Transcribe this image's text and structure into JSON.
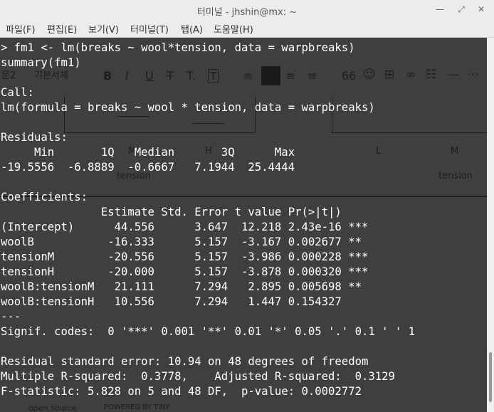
{
  "window": {
    "title": "터미널 - jhshin@mx: ~",
    "controls": [
      "—",
      "⤢",
      "✕"
    ]
  },
  "menu": [
    "파일(F)",
    "편집(E)",
    "보기(V)",
    "터미널(T)",
    "탭(A)",
    "도움말(H)"
  ],
  "background_editor": {
    "style_dropdown": "문2",
    "font_dropdown": "기본서체",
    "plot_labels": [
      "M",
      "H",
      "L",
      "M",
      "tension",
      "tension"
    ],
    "footer": [
      "open source",
      "POWERED BY TINY"
    ],
    "toolbar_icons": [
      "bold-icon",
      "italic-icon",
      "underline-icon",
      "strikethrough-icon",
      "text-color-icon",
      "text-frame-icon",
      "align-left-icon",
      "align-center-icon",
      "align-right-icon",
      "align-justify-icon",
      "quote-icon",
      "emoji-icon",
      "table-icon",
      "link-icon",
      "list-icon",
      "hr-icon",
      "more-icon"
    ]
  },
  "terminal": {
    "lines": [
      "> fm1 <- lm(breaks ~ wool*tension, data = warpbreaks)",
      "summary(fm1)",
      "",
      "Call:",
      "lm(formula = breaks ~ wool * tension, data = warpbreaks)",
      "",
      "Residuals:",
      "     Min       1Q   Median       3Q      Max ",
      "-19.5556  -6.8889  -0.6667   7.1944  25.4444 ",
      "",
      "Coefficients:",
      "               Estimate Std. Error t value Pr(>|t|)    ",
      "(Intercept)      44.556      3.647  12.218 2.43e-16 ***",
      "woolB           -16.333      5.157  -3.167 0.002677 ** ",
      "tensionM        -20.556      5.157  -3.986 0.000228 ***",
      "tensionH        -20.000      5.157  -3.878 0.000320 ***",
      "woolB:tensionM   21.111      7.294   2.895 0.005698 ** ",
      "woolB:tensionH   10.556      7.294   1.447 0.154327    ",
      "---",
      "Signif. codes:  0 '***' 0.001 '**' 0.01 '*' 0.05 '.' 0.1 ' ' 1",
      "",
      "Residual standard error: 10.94 on 48 degrees of freedom",
      "Multiple R-squared:  0.3778,    Adjusted R-squared:  0.3129 ",
      "F-statistic: 5.828 on 5 and 48 DF,  p-value: 0.0002772"
    ]
  }
}
